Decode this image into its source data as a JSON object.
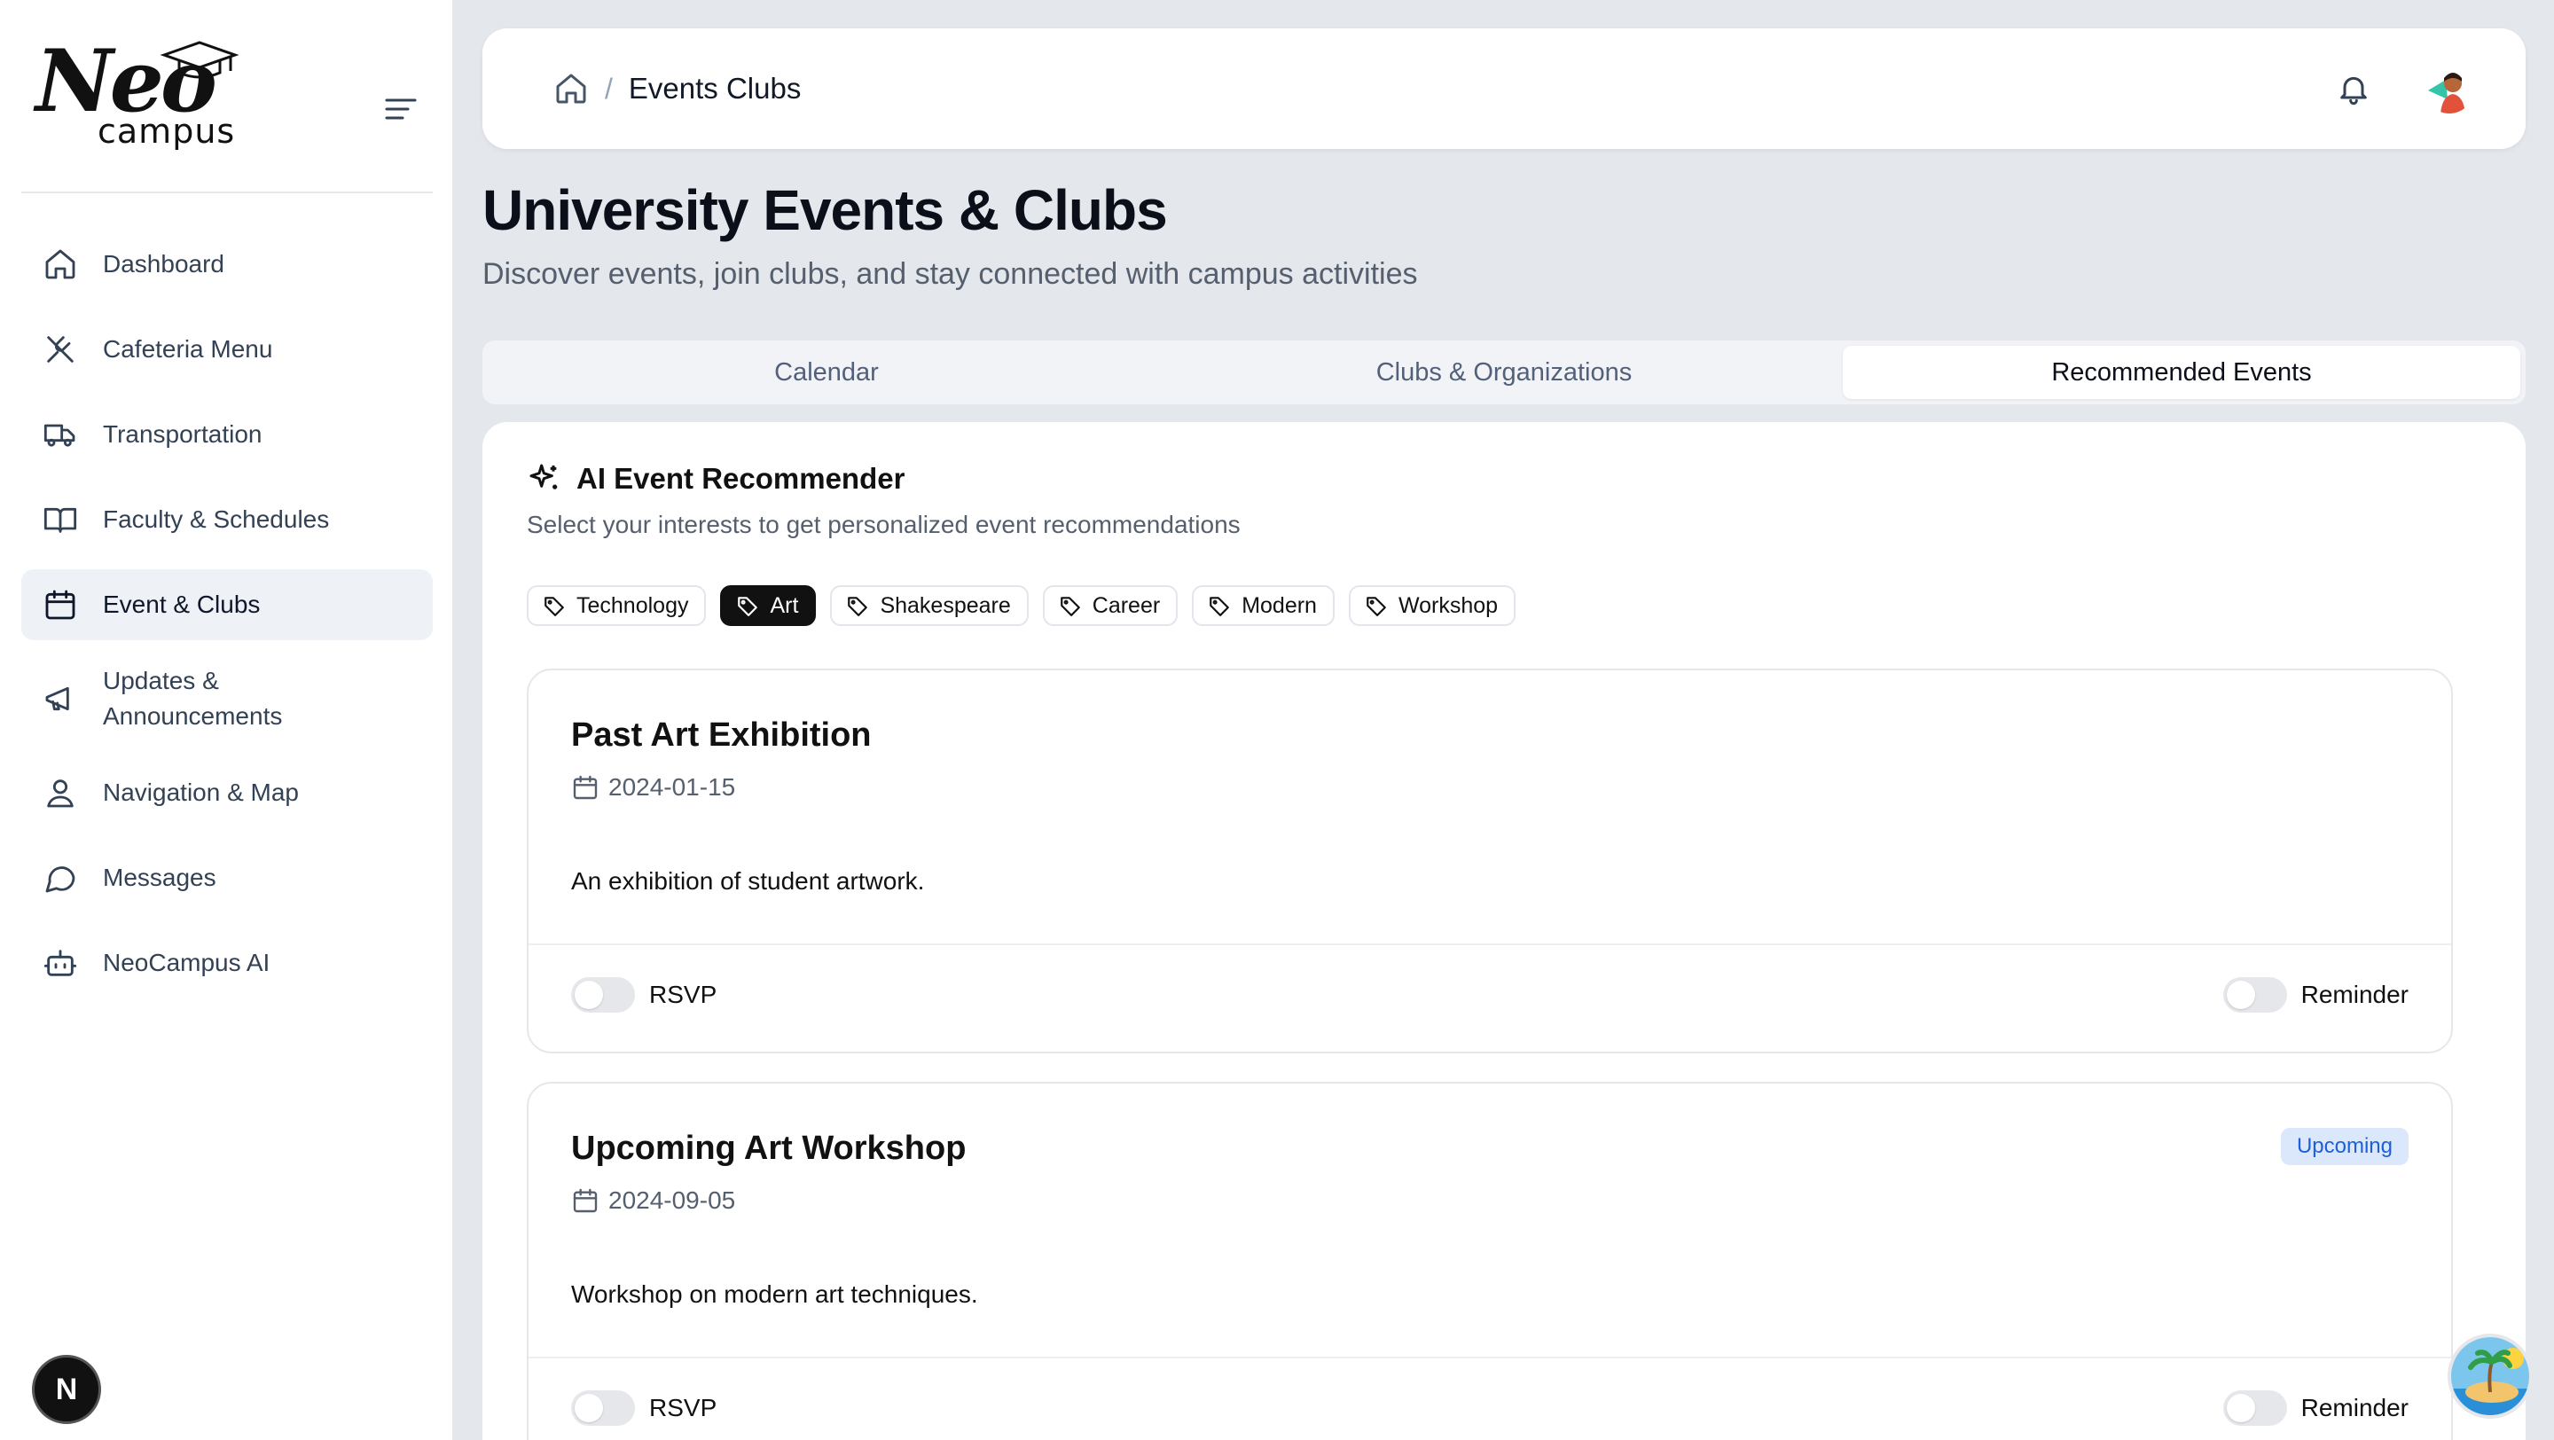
{
  "app": {
    "logo_main": "Neo",
    "logo_sub": "campus"
  },
  "sidebar": {
    "items": [
      {
        "label": "Dashboard",
        "icon": "home-icon"
      },
      {
        "label": "Cafeteria Menu",
        "icon": "utensils-icon"
      },
      {
        "label": "Transportation",
        "icon": "truck-icon"
      },
      {
        "label": "Faculty & Schedules",
        "icon": "book-icon"
      },
      {
        "label": "Event & Clubs",
        "icon": "calendar-icon",
        "active": true
      },
      {
        "label": "Updates & Announcements",
        "icon": "megaphone-icon"
      },
      {
        "label": "Navigation & Map",
        "icon": "map-pin-icon"
      },
      {
        "label": "Messages",
        "icon": "message-icon"
      },
      {
        "label": "NeoCampus AI",
        "icon": "bot-icon"
      }
    ],
    "badge": "N"
  },
  "header": {
    "breadcrumb_current": "Events Clubs",
    "separator": "/"
  },
  "page": {
    "title": "University Events & Clubs",
    "subtitle": "Discover events, join clubs, and stay connected with campus activities"
  },
  "tabs": [
    {
      "label": "Calendar"
    },
    {
      "label": "Clubs & Organizations"
    },
    {
      "label": "Recommended Events",
      "active": true
    }
  ],
  "recommender": {
    "title": "AI Event Recommender",
    "description": "Select your interests to get personalized event recommendations",
    "tags": [
      {
        "label": "Technology",
        "selected": false
      },
      {
        "label": "Art",
        "selected": true
      },
      {
        "label": "Shakespeare",
        "selected": false
      },
      {
        "label": "Career",
        "selected": false
      },
      {
        "label": "Modern",
        "selected": false
      },
      {
        "label": "Workshop",
        "selected": false
      }
    ]
  },
  "events": [
    {
      "title": "Past Art Exhibition",
      "date": "2024-01-15",
      "description": "An exhibition of student artwork.",
      "rsvp_label": "RSVP",
      "reminder_label": "Reminder",
      "badge": ""
    },
    {
      "title": "Upcoming Art Workshop",
      "date": "2024-09-05",
      "description": "Workshop on modern art techniques.",
      "rsvp_label": "RSVP",
      "reminder_label": "Reminder",
      "badge": "Upcoming"
    }
  ],
  "colors": {
    "background": "#e4e7ec",
    "active_nav": "#eef1f6",
    "badge_blue_bg": "#dbe8fb",
    "badge_blue_text": "#1d5fd6"
  }
}
